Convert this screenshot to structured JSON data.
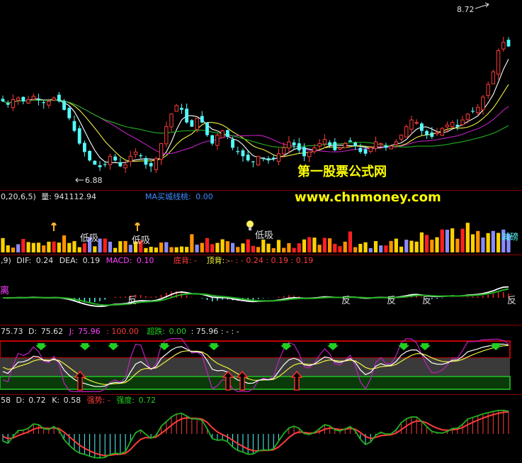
{
  "colors": {
    "bg": "#000000",
    "separator": "#8b0000",
    "up": "#ff3c3c",
    "down": "#54fcfc",
    "ma_white": "#ffffff",
    "ma_yellow": "#f0f040",
    "ma_magenta": "#c020c0",
    "ma_green": "#20b020",
    "vol_yellow": "#ffd200",
    "vol_orange": "#ff9400",
    "vol_red": "#ff2020",
    "vol_blue": "#8a8aff",
    "label_white": "#e0e0e0",
    "label_blue": "#3c8cff",
    "label_magenta": "#ff40ff",
    "label_red": "#ff3c3c",
    "label_green": "#20d020",
    "label_yellow": "#ffff40",
    "watermark": "#ffff00",
    "kdj_band_red": "#c00000",
    "kdj_band_green": "#0a4a0a",
    "kdj_band_gray": "#505050",
    "arrow_green": "#20d020",
    "arrow_red": "#ff3030"
  },
  "icons": {
    "buy_arrow": "red-up-arrow-icon",
    "sell_arrow": "green-down-arrow-icon",
    "torch": "torch-icon",
    "bulb": "light-bulb-icon"
  },
  "price_panel": {
    "high_label": "8.72",
    "low_label": "6.88",
    "ylim": [
      6.7,
      8.85
    ]
  },
  "watermark": {
    "line1": "第一股票公式网",
    "line2": "www.chnmoney.com"
  },
  "volume_panel": {
    "header": {
      "prefix": "0,20,6,5)",
      "vol_label": "量:",
      "vol_value": "941112.94",
      "ma_label": "MA买城线桃:",
      "ma_value": "0.00"
    },
    "annotations": [
      "低吸",
      "低吸",
      "低吸"
    ],
    "right_label": "减磅"
  },
  "macd_panel": {
    "header": {
      "prefix": ",9)",
      "dif_label": "DIF:",
      "dif_value": "0.24",
      "dea_label": "DEA:",
      "dea_value": "0.19",
      "macd_label": "MACD:",
      "macd_value": "0.10",
      "bottom_div": "底背: -",
      "top_div": "顶背: -",
      "extra": ": - : - 0.24 : 0.19 : 0.19"
    },
    "left_label": "离",
    "signals": [
      "反",
      "反",
      "反",
      "反",
      "反"
    ]
  },
  "kdj_panel": {
    "header": {
      "prefix": "75.73",
      "d_label": "D:",
      "d_value": "75.62",
      "j_label": "J:",
      "j_value": "75.96",
      "hundred": ": 100.00",
      "over_label": "超跌:",
      "over_value": "0.00",
      "extra": ": 75.96 : - : -"
    }
  },
  "strength_panel": {
    "header": {
      "prefix": "58",
      "d_label": "D:",
      "d_value": "0.72",
      "k_label": "K:",
      "k_value": "0.58",
      "strong_label": "强势: -",
      "degree_label": "强度:",
      "degree_value": "0.72"
    }
  },
  "chart_data": {
    "type": "candlestick",
    "note_values": "approximate prices read from chart, 100 bars",
    "close": [
      7.7,
      7.66,
      7.72,
      7.74,
      7.7,
      7.72,
      7.76,
      7.72,
      7.68,
      7.7,
      7.74,
      7.7,
      7.6,
      7.5,
      7.35,
      7.2,
      7.1,
      7.0,
      6.95,
      6.92,
      6.95,
      7.05,
      7.0,
      6.93,
      6.95,
      7.05,
      7.1,
      7.05,
      6.95,
      6.93,
      7.02,
      7.2,
      7.4,
      7.55,
      7.65,
      7.6,
      7.45,
      7.4,
      7.5,
      7.45,
      7.3,
      7.2,
      7.3,
      7.35,
      7.28,
      7.15,
      7.1,
      7.05,
      7.0,
      6.98,
      7.05,
      7.03,
      7.0,
      7.02,
      7.08,
      7.15,
      7.22,
      7.18,
      7.12,
      7.05,
      7.1,
      7.15,
      7.2,
      7.25,
      7.18,
      7.12,
      7.15,
      7.2,
      7.22,
      7.17,
      7.1,
      7.08,
      7.15,
      7.22,
      7.2,
      7.15,
      7.17,
      7.22,
      7.3,
      7.4,
      7.48,
      7.45,
      7.35,
      7.3,
      7.28,
      7.33,
      7.38,
      7.42,
      7.45,
      7.4,
      7.48,
      7.55,
      7.58,
      7.63,
      7.75,
      7.9,
      8.05,
      8.3,
      8.4,
      8.35
    ],
    "high_marker": {
      "label": "8.72",
      "value": 8.72
    },
    "low_marker": {
      "label": "6.88",
      "value": 6.88
    }
  }
}
